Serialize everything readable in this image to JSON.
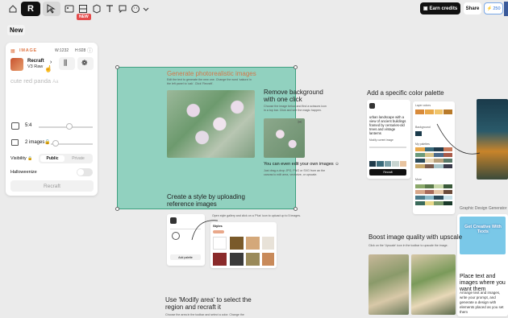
{
  "topbar": {
    "new_badge": "NEW",
    "earn_label": "Earn credits",
    "share_label": "Share",
    "credits_value": "250"
  },
  "panel": {
    "new_label": "New",
    "image_label": "IMAGE",
    "w_label": "W:",
    "w_value": "1232",
    "h_label": "H:",
    "h_value": "928",
    "model_name": "Recraft",
    "model_version": "V3 Raw",
    "prompt": "cute red panda",
    "ratio": "5:4",
    "images_count": "2 images",
    "visibility_label": "Visibility",
    "public": "Public",
    "private": "Private",
    "halloweenize": "Halloweenize",
    "recraft_btn": "Recraft"
  },
  "canvas": {
    "gen_title": "Generate photorealistic images",
    "gen_desc": "Edit the text to generate the new one. Change the word 'sakura' in the left panel to 'oak'. Click 'Recraft'.",
    "remove_title": "Remove background with one click",
    "remove_desc": "Choose the image below and find a scissors icon in a top bar. Click and see the magic happen.",
    "edit_own": "You can even edit your own images",
    "edit_own_desc": "Just drag-n-drop JPG, PNG or SVG from an the canvas to edit area, vectorize, or upscale.",
    "style_title": "Create a style by uploading reference images",
    "style_desc": "Open style gallery and click on a 'Plus' icon to upload up to 5 images.",
    "palette_title": "Add a specific color palette",
    "boost_title": "Boost image quality with upscale",
    "boost_desc": "Click on the 'Upscale' icon in the toolbar to upscale the image.",
    "modify_title": "Use 'Modify area' to select the region and recraft it",
    "modify_desc": "Choose the area in the toolbar and select a color. Change the",
    "graphic_label": "Graphic Design Generator",
    "place_text_title": "Place text and images where you want them",
    "place_text_desc": "Arrange text and images, write your prompt, and generate a design with elements placed as you set them",
    "get_creative": "Get Creative With Texts",
    "palette_card": {
      "prompt": "urban landscape with a view of ancient buildings framed by centuries-old trees and vintage lanterns",
      "modify_label": "Modify current image",
      "recraft": "Recraft",
      "layer_colors": "Layer colors",
      "background": "Background",
      "my_palettes": "My palettes",
      "more": "More"
    },
    "style_card": {
      "styles": "Styles",
      "add_palette": "Add palette"
    }
  },
  "colors": {
    "accent_orange": "#e07a4a",
    "selection_fill": "#66c4aa",
    "earn_bg": "#111111",
    "credits_blue": "#2a6fd6"
  }
}
